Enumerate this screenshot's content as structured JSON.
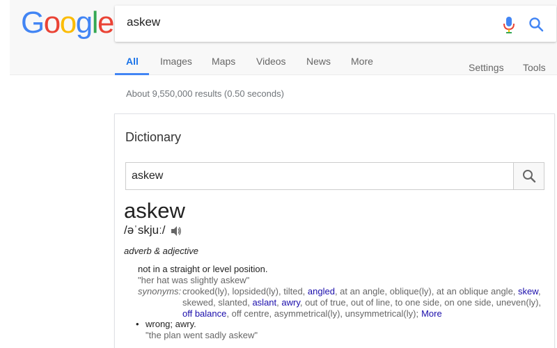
{
  "logo": {
    "letters": [
      "G",
      "o",
      "o",
      "g",
      "l",
      "e"
    ],
    "colors": [
      "#4285f4",
      "#ea4335",
      "#fbbc05",
      "#4285f4",
      "#34a853",
      "#ea4335"
    ]
  },
  "search": {
    "value": "askew"
  },
  "nav": {
    "tabs": [
      "All",
      "Images",
      "Maps",
      "Videos",
      "News",
      "More"
    ],
    "settings": "Settings",
    "tools": "Tools"
  },
  "stats": "About 9,550,000 results (0.50 seconds)",
  "dictionary": {
    "title": "Dictionary",
    "search_value": "askew",
    "word": "askew",
    "phonetic": "/əˈskjuː/",
    "part_of_speech": "adverb & adjective",
    "def1": {
      "text": "not in a straight or level position.",
      "example": "\"her hat was slightly askew\"",
      "synonyms_label": "synonyms:",
      "synonyms": [
        {
          "t": "crooked(ly), lopsided(ly), tilted, ",
          "link": false
        },
        {
          "t": "angled",
          "link": true
        },
        {
          "t": ", at an angle, oblique(ly), at an oblique angle, ",
          "link": false
        },
        {
          "t": "skew",
          "link": true
        },
        {
          "t": ", skewed, slanted, ",
          "link": false
        },
        {
          "t": "aslant",
          "link": true
        },
        {
          "t": ", ",
          "link": false
        },
        {
          "t": "awry",
          "link": true
        },
        {
          "t": ", out of true, out of line, to one side, on one side, uneven(ly), ",
          "link": false
        },
        {
          "t": "off balance",
          "link": true
        },
        {
          "t": ", off centre, asymmetrical(ly), unsymmetrical(ly);",
          "link": false
        }
      ],
      "more": "More"
    },
    "def2": {
      "text": "wrong; awry.",
      "example": "\"the plan went sadly askew\""
    }
  },
  "colors": {
    "accent": "#4285f4",
    "link": "#1a0dab"
  }
}
